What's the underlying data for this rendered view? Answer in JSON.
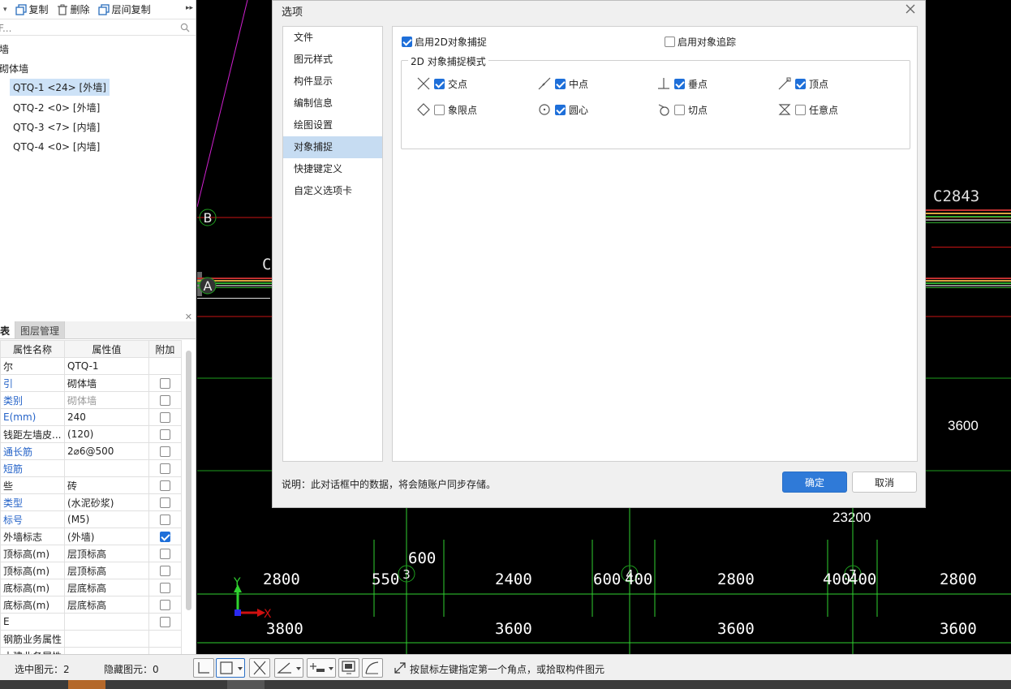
{
  "left_toolbar": {
    "copy": "复制",
    "delete": "删除",
    "floor_copy": "层间复制"
  },
  "search": {
    "placeholder": "F..."
  },
  "tree": {
    "nodes": [
      "墙",
      "砌体墙",
      "QTQ-1 <24> [外墙]",
      "QTQ-2 <0> [外墙]",
      "QTQ-3 <7> [内墙]",
      "QTQ-4 <0> [内墙]"
    ]
  },
  "prop_tabs": [
    "表",
    "图层管理"
  ],
  "prop_table": {
    "headers": [
      "属性名称",
      "属性值",
      "附加"
    ],
    "rows": [
      {
        "name": "尔",
        "value": "QTQ-1",
        "blue": false,
        "grey": false,
        "check": null
      },
      {
        "name": "引",
        "value": "砌体墙",
        "blue": true,
        "grey": false,
        "check": false
      },
      {
        "name": "类别",
        "value": "砌体墙",
        "blue": true,
        "grey": true,
        "check": false
      },
      {
        "name": "E(mm)",
        "value": "240",
        "blue": true,
        "grey": false,
        "check": false
      },
      {
        "name": "钱距左墙皮...",
        "value": "(120)",
        "blue": false,
        "grey": false,
        "check": false
      },
      {
        "name": "通长筋",
        "value": "2⌀6@500",
        "blue": true,
        "grey": false,
        "check": false
      },
      {
        "name": "短筋",
        "value": "",
        "blue": true,
        "grey": false,
        "check": false
      },
      {
        "name": "些",
        "value": "砖",
        "blue": false,
        "grey": false,
        "check": false
      },
      {
        "name": "类型",
        "value": "(水泥砂浆)",
        "blue": true,
        "grey": false,
        "check": false
      },
      {
        "name": "标号",
        "value": "(M5)",
        "blue": true,
        "grey": false,
        "check": false
      },
      {
        "name": "外墙标志",
        "value": "(外墙)",
        "blue": false,
        "grey": false,
        "check": true
      },
      {
        "name": "顶标高(m)",
        "value": "层顶标高",
        "blue": false,
        "grey": false,
        "check": false
      },
      {
        "name": "顶标高(m)",
        "value": "层顶标高",
        "blue": false,
        "grey": false,
        "check": false
      },
      {
        "name": "底标高(m)",
        "value": "层底标高",
        "blue": false,
        "grey": false,
        "check": false
      },
      {
        "name": "底标高(m)",
        "value": "层底标高",
        "blue": false,
        "grey": false,
        "check": false
      },
      {
        "name": "E",
        "value": "",
        "blue": false,
        "grey": false,
        "check": false
      },
      {
        "name": "钢筋业务属性",
        "value": "",
        "blue": false,
        "grey": false,
        "check": null
      },
      {
        "name": "土建业务属性",
        "value": "",
        "blue": false,
        "grey": false,
        "check": null
      }
    ]
  },
  "cad": {
    "axis_labels": [
      "B",
      "A",
      "3",
      "4",
      "7"
    ],
    "text_labels": [
      "C2843",
      "C",
      "3600",
      "23200",
      "600",
      "2800",
      "550",
      "2400",
      "600",
      "400",
      "2800",
      "400",
      "400",
      "2800",
      "3800",
      "3600",
      "3600",
      "3600"
    ],
    "axis_x": "X",
    "axis_y": "Y"
  },
  "dialog": {
    "title": "选项",
    "nav": [
      "文件",
      "图元样式",
      "构件显示",
      "编制信息",
      "绘图设置",
      "对象捕捉",
      "快捷键定义",
      "自定义选项卡"
    ],
    "active_nav": 5,
    "enable_2d_snap": {
      "label": "启用2D对象捕捉",
      "checked": true
    },
    "enable_tracking": {
      "label": "启用对象追踪",
      "checked": false
    },
    "group_title": "2D 对象捕捉模式",
    "snap_modes": [
      {
        "label": "交点",
        "checked": true,
        "icon": "intersection-icon"
      },
      {
        "label": "中点",
        "checked": true,
        "icon": "midpoint-icon"
      },
      {
        "label": "垂点",
        "checked": true,
        "icon": "perpendicular-icon"
      },
      {
        "label": "顶点",
        "checked": true,
        "icon": "endpoint-icon"
      },
      {
        "label": "象限点",
        "checked": false,
        "icon": "quadrant-icon"
      },
      {
        "label": "圆心",
        "checked": true,
        "icon": "center-icon"
      },
      {
        "label": "切点",
        "checked": false,
        "icon": "tangent-icon"
      },
      {
        "label": "任意点",
        "checked": false,
        "icon": "nearest-icon"
      }
    ],
    "note": "说明：此对话框中的数据，将会随账户同步存储。",
    "ok": "确定",
    "cancel": "取消"
  },
  "status_bar": {
    "selected": "选中图元：2",
    "hidden": "隐藏图元：0",
    "hint": "按鼠标左键指定第一个角点，或拾取构件图元"
  },
  "colors": {
    "accent": "#2f7ad8",
    "cad_bg": "#000000",
    "grid_green": "#2fd12f",
    "axis_red": "#d01010"
  }
}
